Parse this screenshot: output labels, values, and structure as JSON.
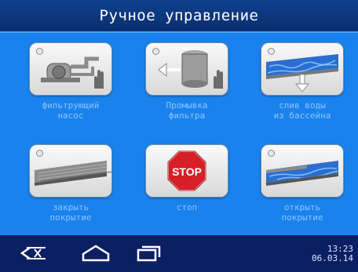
{
  "header": {
    "title": "Ручное управление"
  },
  "tiles": [
    {
      "line1": "фильтрующий",
      "line2": "насос"
    },
    {
      "line1": "Промывка",
      "line2": "фильтра"
    },
    {
      "line1": "слив воды",
      "line2": "из бассейна"
    },
    {
      "line1": "закрыть",
      "line2": "покрытие"
    },
    {
      "line1": "стоп",
      "line2": "",
      "sign": "STOP"
    },
    {
      "line1": "открыть",
      "line2": "покрытие"
    }
  ],
  "navbar": {
    "icons": [
      "back-icon",
      "home-icon",
      "recent-apps-icon"
    ],
    "time": "13:23",
    "date": "06.03.14"
  },
  "colors": {
    "background": "#1a82ec",
    "title_bar": "#0b2e6c",
    "nav_bar": "#0d1f63",
    "label_text": "#8cc4ff",
    "stop_red": "#d61f26"
  }
}
